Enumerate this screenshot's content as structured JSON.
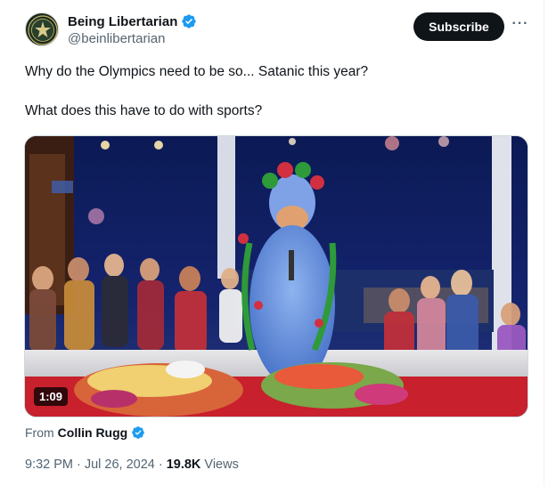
{
  "author": {
    "display_name": "Being Libertarian",
    "handle": "@beinlibertarian",
    "verified": true
  },
  "actions": {
    "subscribe_label": "Subscribe",
    "more_label": "···"
  },
  "tweet": {
    "paragraphs": [
      "Why do the Olympics need to be so... Satanic this year?",
      "What does this have to do with sports?"
    ]
  },
  "media": {
    "type": "video",
    "duration": "1:09"
  },
  "source": {
    "from_label": "From",
    "from_name": "Collin Rugg",
    "verified": true
  },
  "meta": {
    "time": "9:32 PM",
    "separator": "·",
    "date": "Jul 26, 2024",
    "views_count": "19.8K",
    "views_label": "Views"
  },
  "colors": {
    "verified_blue": "#1d9bf0",
    "text_primary": "#0f1419",
    "text_secondary": "#536471",
    "button_dark": "#0f1419"
  }
}
